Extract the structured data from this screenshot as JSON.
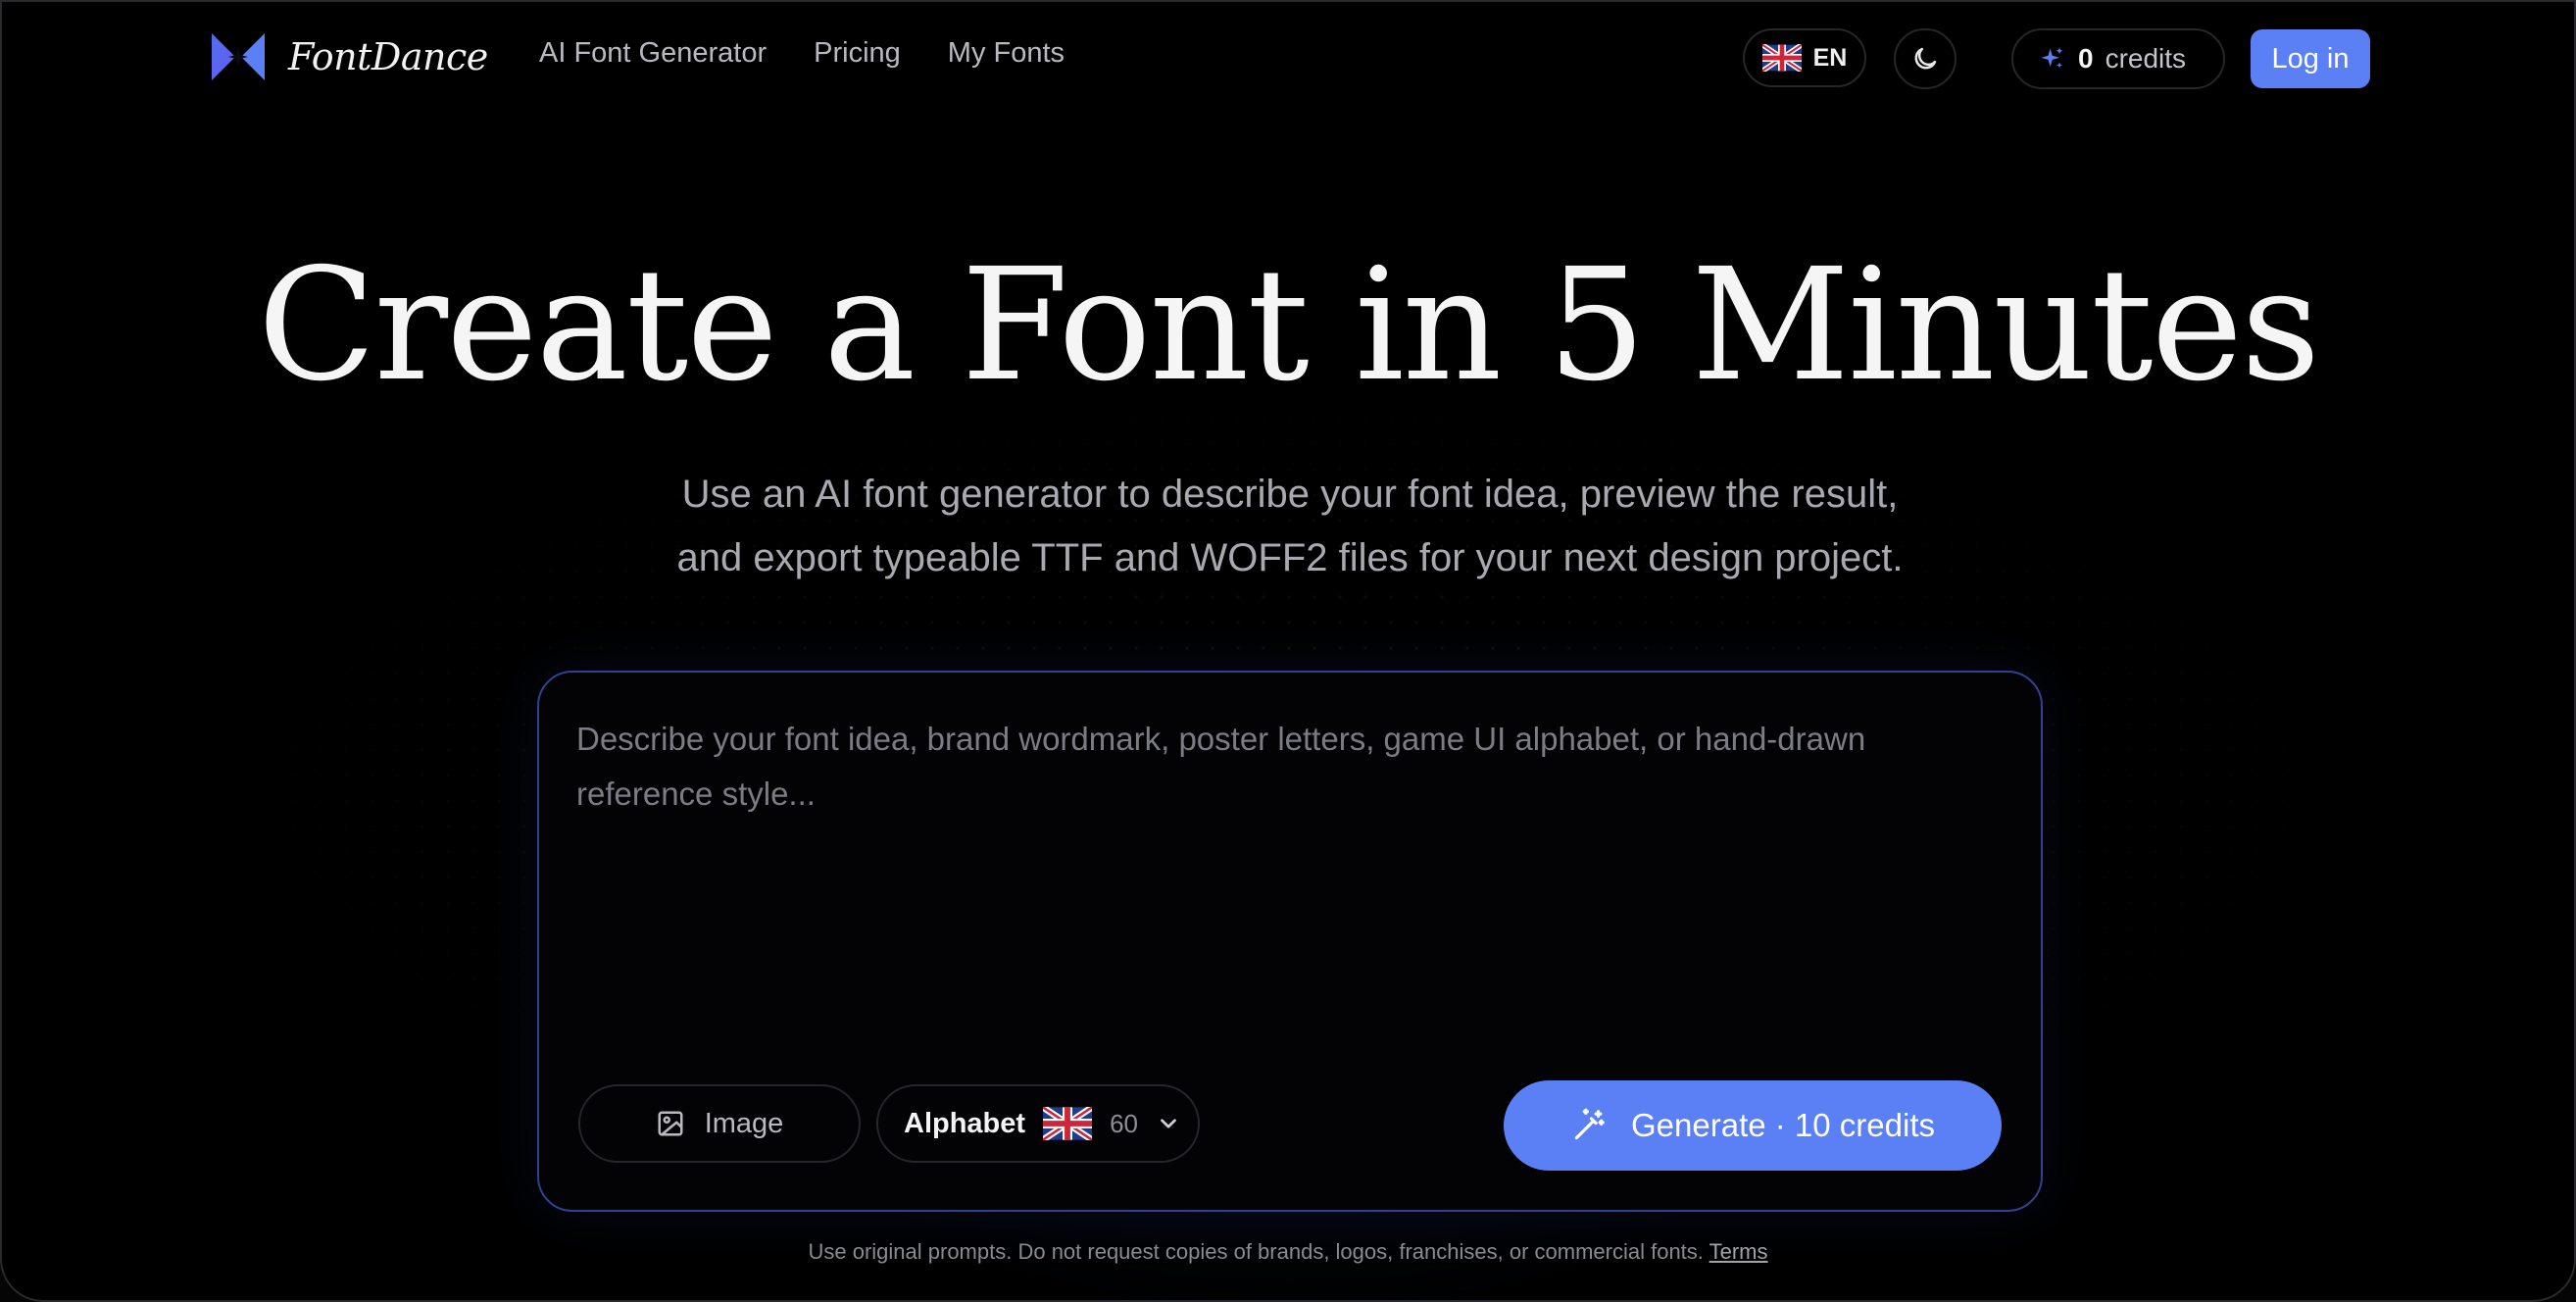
{
  "brand": {
    "name": "FontDance",
    "accent_color": "#5b7ff4",
    "logo_icon": "fontdance-logo-icon"
  },
  "nav": {
    "links": [
      "AI Font Generator",
      "Pricing",
      "My Fonts"
    ],
    "language": {
      "code": "EN",
      "flag_icon": "uk-flag-icon"
    },
    "theme_icon": "moon-icon",
    "credits": {
      "count": "0",
      "label": "credits",
      "icon": "sparkles-icon"
    },
    "login_label": "Log in"
  },
  "hero": {
    "title": "Create a Font in 5 Minutes",
    "subtitle_line1": "Use an AI font generator to describe your font idea, preview the result,",
    "subtitle_line2": "and export typeable TTF and WOFF2 files for your next design project."
  },
  "prompt_box": {
    "placeholder": "Describe your font idea, brand wordmark, poster letters, game UI alphabet, or hand-drawn reference style...",
    "value": "",
    "image_button": {
      "label": "Image",
      "icon": "image-icon"
    },
    "alphabet_select": {
      "label": "Alphabet",
      "flag_icon": "uk-flag-icon",
      "count": "60",
      "icon": "chevron-down-icon"
    },
    "generate_button": {
      "label": "Generate · 10 credits",
      "icon": "magic-wand-icon"
    }
  },
  "footer": {
    "note": "Use original prompts. Do not request copies of brands, logos, franchises, or commercial fonts.",
    "terms_link": "Terms"
  }
}
